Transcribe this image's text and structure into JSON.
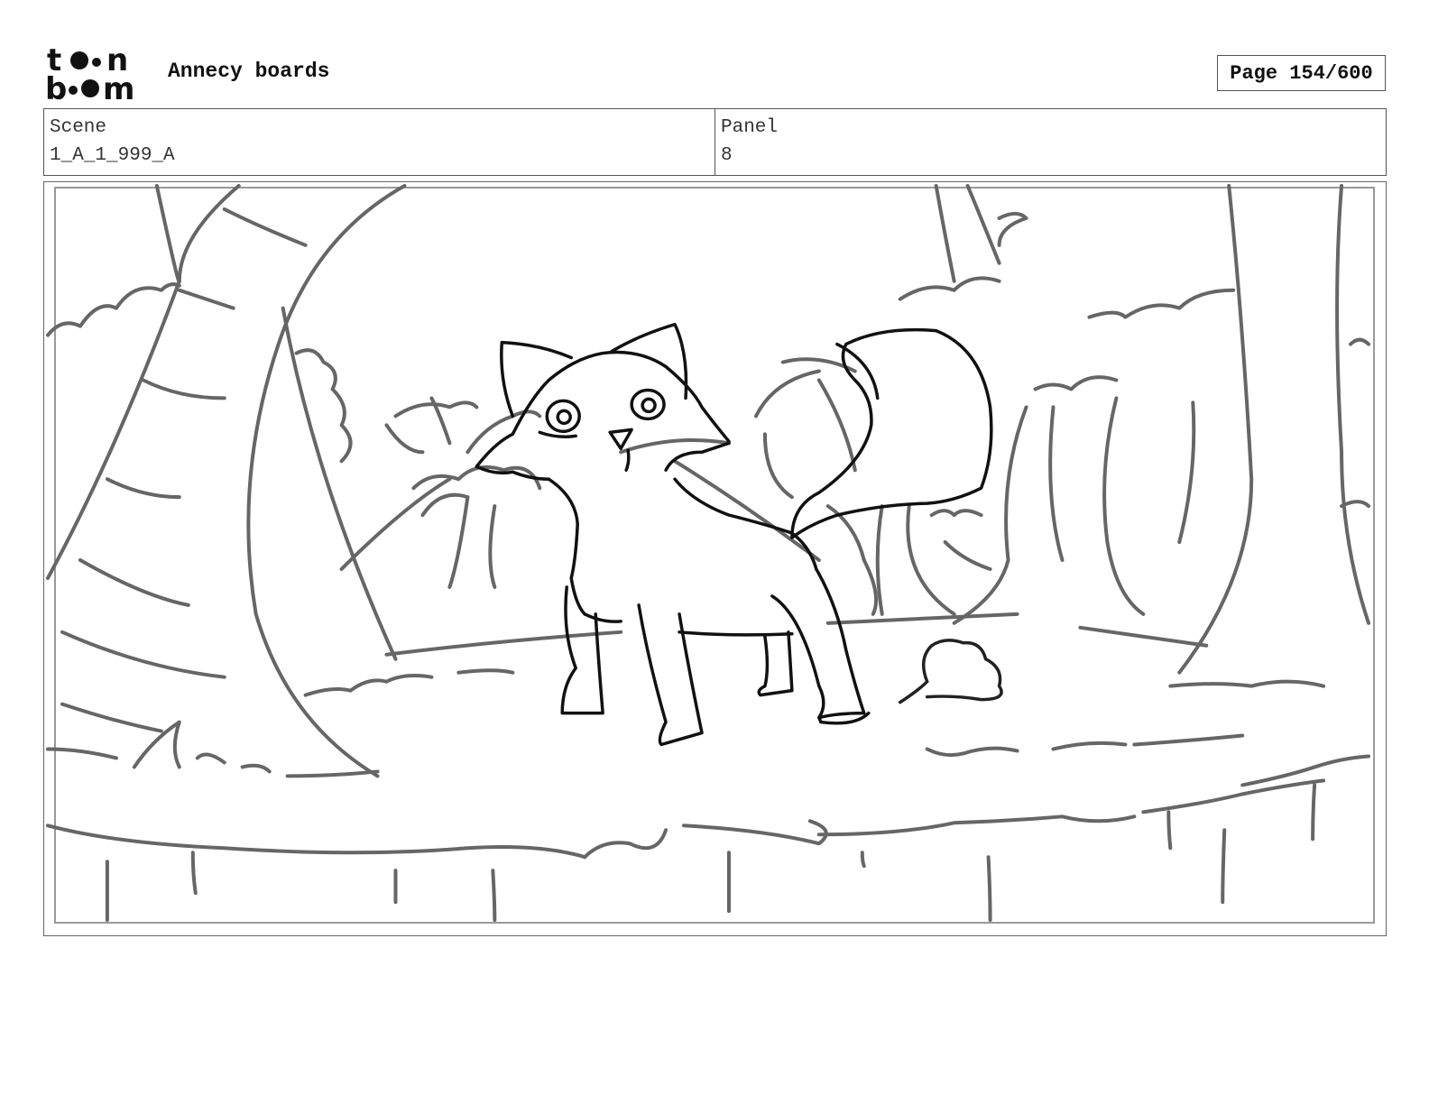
{
  "header": {
    "logo_alt": "toon boom",
    "project_title": "Annecy boards",
    "page_label": "Page 154/600"
  },
  "info": {
    "scene_label": "Scene",
    "scene_value": "1_A_1_999_A",
    "panel_label": "Panel",
    "panel_value": "8"
  },
  "panel": {
    "content": "sketch"
  }
}
